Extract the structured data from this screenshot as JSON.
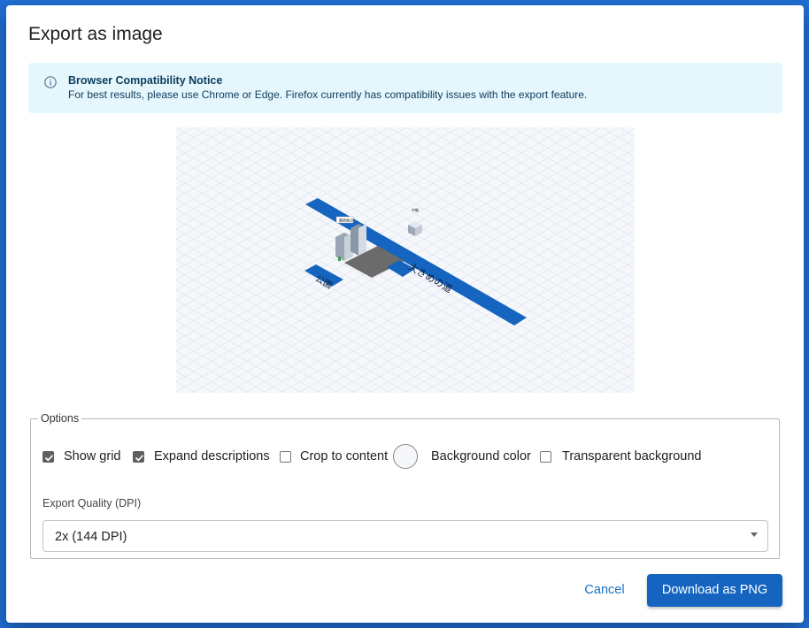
{
  "dialog": {
    "title": "Export as image"
  },
  "notice": {
    "icon": "info-icon",
    "title": "Browser Compatibility Notice",
    "body": "For best results, please use Chrome or Edge. Firefox currently has compatibility issues with the export feature."
  },
  "preview": {
    "road_label": "大きめの道",
    "park_label": "公園",
    "building_tag": "最終拠点",
    "cube_tag": "中継",
    "road_color": "#1565c0",
    "grid_color": "#dde3ee"
  },
  "options": {
    "legend": "Options",
    "show_grid": {
      "label": "Show grid",
      "checked": true
    },
    "expand_descriptions": {
      "label": "Expand descriptions",
      "checked": true
    },
    "crop_to_content": {
      "label": "Crop to content",
      "checked": false
    },
    "background_color": {
      "label": "Background color",
      "value": "#f5f7fb"
    },
    "transparent_background": {
      "label": "Transparent background",
      "checked": false
    },
    "dpi_label": "Export Quality (DPI)",
    "dpi_value": "2x (144 DPI)"
  },
  "actions": {
    "cancel": "Cancel",
    "download": "Download as PNG"
  }
}
